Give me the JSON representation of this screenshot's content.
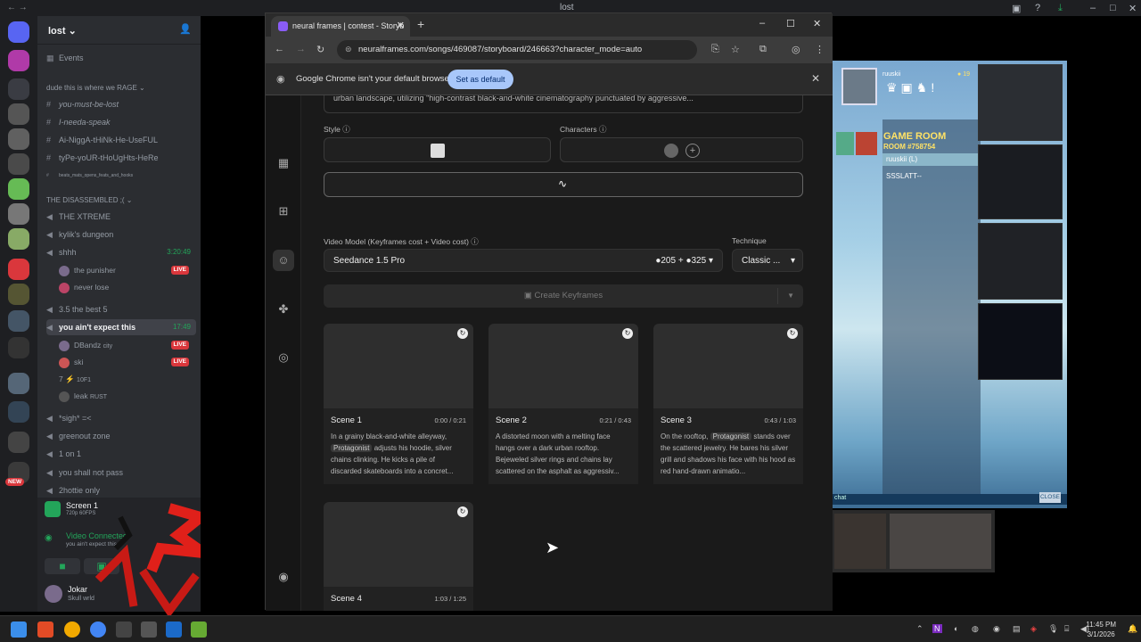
{
  "discord": {
    "window_title": "lost",
    "server_name": "lost",
    "channels": [
      {
        "name": "Events"
      },
      {
        "category": "dude this is where we RAGE"
      },
      {
        "name": "you-must-be-lost"
      },
      {
        "name": "I-needa-speak"
      },
      {
        "name": "Ai-NiggA-tHiNk-He-UseFUL"
      },
      {
        "name": "tyPe-yoUR-tHoUgHts-HeRe"
      },
      {
        "name": "beats_mats_opens_feats_and_hooks"
      },
      {
        "category": "THE DISASSEMBLED ;("
      },
      {
        "name": "THE XTREME"
      },
      {
        "name": "kylik's dungeon"
      },
      {
        "name": "shhh",
        "time": "3:20:49"
      },
      {
        "name": "3.5 the best 5"
      },
      {
        "name": "you ain't expect this",
        "time": "17:49"
      },
      {
        "name": "*sigh* =<"
      },
      {
        "name": "greenout zone"
      },
      {
        "name": "1 on 1"
      },
      {
        "name": "you shall not pass"
      },
      {
        "name": "2hottie only"
      }
    ],
    "voice_users_shhh": [
      {
        "name": "the punisher",
        "badge": "LIVE"
      },
      {
        "name": "never lose"
      }
    ],
    "voice_users_expect": [
      {
        "name": "DBandz",
        "status": "city",
        "badge": "LIVE"
      },
      {
        "name": "ski",
        "badge": "LIVE"
      },
      {
        "name": "7",
        "status": "10F1"
      },
      {
        "name": "leak",
        "status": "RUST"
      }
    ],
    "screen_panel": {
      "title": "Screen 1",
      "sub": "720p 60FPS"
    },
    "video_panel": {
      "title": "Video Connected",
      "sub": "you ain't expect this /"
    },
    "user": {
      "name": "Jokar",
      "status": "Skull wrld"
    },
    "new_badge": "NEW",
    "live_badge": "LIVE"
  },
  "chrome": {
    "tab_title": "neural frames | contest - Storyb",
    "url": "neuralframes.com/songs/469087/storyboard/246663?character_mode=auto",
    "infobar_text": "Google Chrome isn't your default browser",
    "set_default_label": "Set as default"
  },
  "app": {
    "prompt_text": "urban landscape, utilizing \"high-contrast black-and-white cinematography punctuated by aggressive...",
    "style_label": "Style",
    "characters_label": "Characters",
    "video_model_label": "Video Model (Keyframes cost + Video cost)",
    "technique_label": "Technique",
    "model_name": "Seedance 1.5 Pro",
    "cost_keyframes": "205",
    "cost_plus": "+",
    "cost_video": "325",
    "technique_value": "Classic ...",
    "create_keyframes_label": "Create Keyframes",
    "scenes": [
      {
        "name": "Scene 1",
        "time": "0:00 / 0:21",
        "pre": "In a grainy black-and-white alleyway,",
        "tag": "Protagonist",
        "post": "adjusts his hoodie, silver chains clinking. He kicks a pile of discarded skateboards into a concret..."
      },
      {
        "name": "Scene 2",
        "time": "0:21 / 0:43",
        "pre": "A distorted moon with a melting face hangs over a dark urban rooftop. Bejeweled silver rings and chains lay scattered on the asphalt as aggressiv...",
        "tag": "",
        "post": ""
      },
      {
        "name": "Scene 3",
        "time": "0:43 / 1:03",
        "pre": "On the rooftop,",
        "tag": "Protagonist",
        "post": "stands over the scattered jewelry. He bares his silver grill and shadows his face with his hood as red hand-drawn animatio..."
      },
      {
        "name": "Scene 4",
        "time": "1:03 / 1:25",
        "pre": "",
        "tag": "",
        "post": ""
      }
    ]
  },
  "game": {
    "top_user": "ruuskii",
    "top_value": "19",
    "room_title": "GAME ROOM",
    "room_number": "ROOM #758754",
    "players": [
      "ruuskii (L)",
      "SSSLATT--"
    ],
    "chat_label": "chat",
    "close_label": "CLOSE"
  },
  "taskbar": {
    "time": "11:45 PM",
    "date": "3/1/2026"
  },
  "colors": {
    "discord_bg": "#2b2d31",
    "chrome_bg": "#1f1f1f",
    "accent_blue": "#a8c7fa",
    "live_red": "#da373c",
    "game_yellow": "#ffe266"
  }
}
